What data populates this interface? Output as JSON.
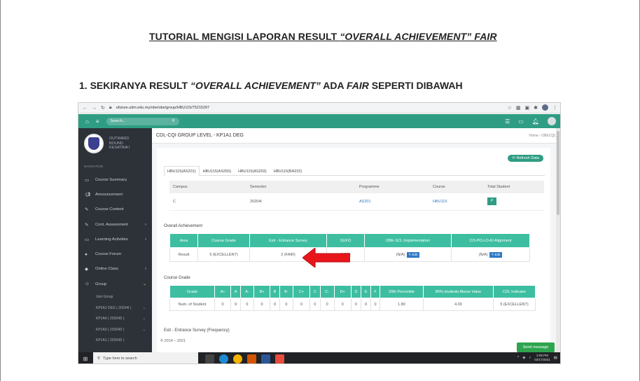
{
  "doc": {
    "title_pre": "TUTORIAL MENGISI LAPORAN RESULT ",
    "title_em": "“OVERALL ACHIEVEMENT” FAIR",
    "heading_pre": "1. SEKIRANYA RESULT ",
    "heading_em1": "“OVERALL ACHIEVEMENT”",
    "heading_mid": " ADA ",
    "heading_em2": "FAIR",
    "heading_post": " SEPERTI DIBAWAH"
  },
  "browser": {
    "url": "ufuture.uitm.edu.my/obe/obe/group/HBU115/75215297"
  },
  "topbar": {
    "search_placeholder": "Search..."
  },
  "sidebar": {
    "brand_line1": "OUTWARD",
    "brand_line2": "BOUND",
    "brand_line3": "KESATRIA I",
    "nav_header": "NAVIGATION",
    "items": [
      {
        "label": "Course Summary",
        "icon": "monitor-icon"
      },
      {
        "label": "Announcement",
        "icon": "megaphone-icon"
      },
      {
        "label": "Course Content",
        "icon": "pencil-icon"
      },
      {
        "label": "Cont. Assessment",
        "icon": "pencil-icon"
      },
      {
        "label": "Learning Activities",
        "icon": "monitor-icon"
      },
      {
        "label": "Course Forum",
        "icon": "chat-icon"
      },
      {
        "label": "Online Class",
        "icon": "graduation-cap-icon"
      },
      {
        "label": "Group",
        "icon": "user-icon"
      }
    ],
    "subitems": [
      {
        "label": "Join Group"
      },
      {
        "label": "KP2A1 DEG ( 20204I )"
      },
      {
        "label": "KP1A4 ( 20204D )"
      },
      {
        "label": "KP1A3 ( 20204D )"
      },
      {
        "label": "KP1A1 ( 20204D )"
      }
    ]
  },
  "page": {
    "title": "CDL-CQI GROUP LEVEL - KP1A1 DEG",
    "breadcrumb": "Home  ›  OBECQL",
    "refresh_label": "⟳ Refresh Data",
    "tabs": [
      "HBU115(AS201)",
      "HBU115(AS255)",
      "HBU115(AS203)",
      "HBU115(BA232)"
    ],
    "info_headers": [
      "Campus",
      "Semester",
      "Programme",
      "Course",
      "Total Student"
    ],
    "info_values": [
      "C",
      "20204I",
      "AS201",
      "HBU115",
      "P"
    ],
    "overall_title": "Overall Achievement",
    "oa_headers": [
      "Area",
      "Course Grade",
      "Exit - Entrance Survey",
      "SUFO",
      "OBE-SCL Implementation",
      "CO-PO-LO-KI Alignment"
    ],
    "oa_row": [
      "Result",
      "5 (EXCELLENT)",
      "2 (FAIR)",
      "OOD)",
      "(N/A)",
      "(N/A)"
    ],
    "edit_label": "✎ Edit",
    "cg_title": "Course Grade",
    "cg_headers": [
      "Grade",
      "A+",
      "A",
      "A-",
      "B+",
      "B",
      "B-",
      "C+",
      "C",
      "C-",
      "D+",
      "D",
      "E",
      "F",
      "20th Percentile",
      "80% students Above Value",
      "CDL Indicator"
    ],
    "cg_row": [
      "Num. of Student",
      "0",
      "9",
      "0",
      "0",
      "0",
      "0",
      "0",
      "0",
      "0",
      "0",
      "0",
      "0",
      "0",
      "1.80",
      "4.00",
      "5 (EXCELLENT)"
    ],
    "survey_title": "Exit - Entrance Survey (Frequency)",
    "footer": "© 2014 – 2021",
    "send_message": "Send message"
  },
  "taskbar": {
    "search": "Type here to search",
    "time": "2:09 PM",
    "date": "03/17/2021"
  },
  "colors": {
    "accent": "#3dbea1",
    "topbar": "#2e9d83",
    "sidebar": "#2d3238",
    "arrow": "#e8161b"
  }
}
